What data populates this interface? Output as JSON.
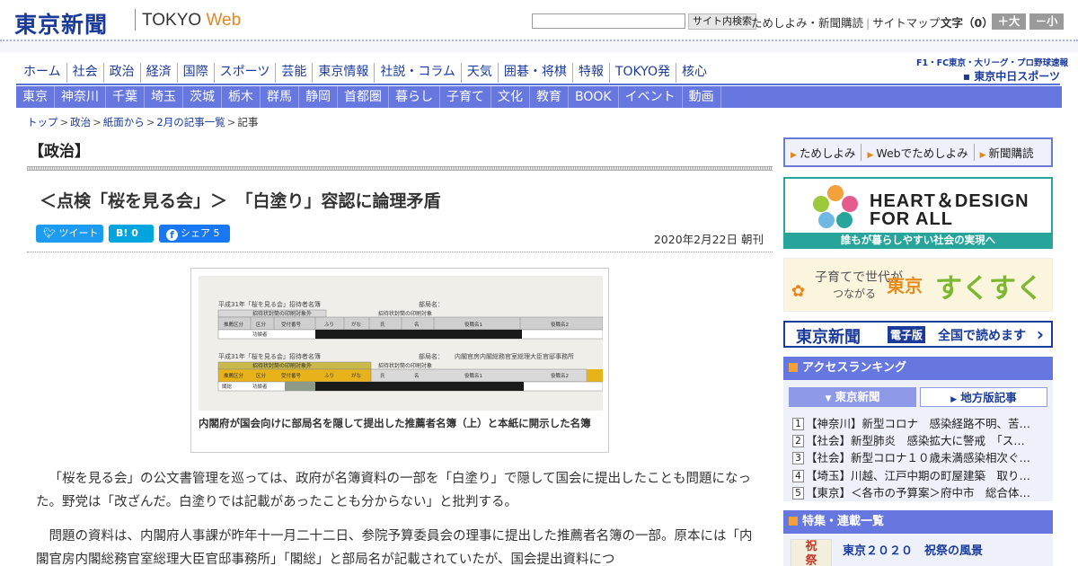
{
  "header": {
    "logo": "東京新聞",
    "logo_sub_a": "TOKYO ",
    "logo_sub_b": "Web",
    "search_button": "サイト内検索",
    "link_trial": "ためしよみ・新聞購読",
    "link_sitemap": "サイトマップ",
    "font_size_label": "文字（0）",
    "font_plus": "＋大",
    "font_minus": "－小"
  },
  "main_nav": [
    "ホーム",
    "社会",
    "政治",
    "経済",
    "国際",
    "スポーツ",
    "芸能",
    "東京情報",
    "社説・コラム",
    "天気",
    "囲碁・将棋",
    "特報",
    "TOKYO発",
    "核心"
  ],
  "chunichi": {
    "top": "F1・FC東京・大リーグ・プロ野球速報",
    "bottom": "▪ 東京中日スポーツ"
  },
  "sub_nav": [
    "東京",
    "神奈川",
    "千葉",
    "埼玉",
    "茨城",
    "栃木",
    "群馬",
    "静岡",
    "首都圏",
    "暮らし",
    "子育て",
    "文化",
    "教育",
    "BOOK",
    "イベント",
    "動画"
  ],
  "breadcrumb": [
    "トップ",
    "政治",
    "紙面から",
    "2月の記事一覧",
    "記事"
  ],
  "article": {
    "section": "【政治】",
    "headline": "＜点検「桜を見る会」＞　「白塗り」容認に論理矛盾",
    "share_tweet": "ツイート",
    "share_hatena": "B! 0",
    "share_facebook": "シェア 5",
    "date": "2020年2月22日 朝刊",
    "figure_caption": "内閣府が国会向けに部局名を隠して提出した推薦者名簿（上）と本紙に開示した名簿",
    "fig_doc_title": "平成31年「桜を見る会」招待者名簿",
    "fig_dept_label": "部局名：",
    "fig_dept_value": "内閣官房内閣総務官室総理大臣官邸事務所",
    "fig_h_outside": "招待状封筒の印刷対象外",
    "fig_h_target": "招待状封筒の印刷対象",
    "fig_cols": [
      "推薦区分",
      "区分",
      "受付番号",
      "ふり",
      "がな",
      "氏",
      "名",
      "役職名1",
      "役職名2"
    ],
    "fig_row_top": "功績者",
    "fig_row_bottom_a": "閣総",
    "fig_row_bottom_b": "功績者",
    "para1": "「桜を見る会」の公文書管理を巡っては、政府が名簿資料の一部を「白塗り」で隠して国会に提出したことも問題になった。野党は「改ざんだ。白塗りでは記載があったことも分からない」と批判する。",
    "para2": "問題の資料は、内閣府人事課が昨年十一月二十二日、参院予算委員会の理事に提出した推薦者名簿の一部。原本には「内閣官房内閣総務官室総理大臣官邸事務所」「閣総」と部局名が記載されていたが、国会提出資料につ"
  },
  "sidebar": {
    "trial_links": [
      "ためしよみ",
      "Webでためしよみ",
      "新聞購読"
    ],
    "hdfa_line1": "HEART＆DESIGN",
    "hdfa_line2": "FOR ALL",
    "hdfa_bar": "誰もが暮らしやすい社会の実現へ",
    "suku_a": "子育てで世代が",
    "suku_b": "つながる",
    "suku_c": "東京",
    "suku_d": "すくすく",
    "denshi_name": "東京新聞",
    "denshi_badge": "電子版",
    "denshi_text": "全国で読めます",
    "ranking_title": "アクセスランキング",
    "ranking_tab_on": "東京新聞",
    "ranking_tab_off": "地方版記事",
    "ranking": [
      {
        "num": "1",
        "text": "【神奈川】新型コロナ　感染経路不明、苦…"
      },
      {
        "num": "2",
        "text": "【社会】新型肺炎　感染拡大に警戒　「ス…"
      },
      {
        "num": "3",
        "text": "【社会】新型コロナ１０歳未満感染相次ぐ…"
      },
      {
        "num": "4",
        "text": "【埼玉】川越、江戸中期の町屋建築　取り…"
      },
      {
        "num": "5",
        "text": "【東京】＜各市の予算案＞府中市　総合体…"
      }
    ],
    "feature_title": "特集・連載一覧",
    "feature_thumb_a": "祝",
    "feature_thumb_b": "祭",
    "feature_item": "東京２０２０　祝祭の風景"
  },
  "colors": {
    "brand_blue": "#1b3b9a",
    "nav_blue": "#6677e0",
    "accent_orange": "#e8851c",
    "teal": "#27a59b"
  }
}
